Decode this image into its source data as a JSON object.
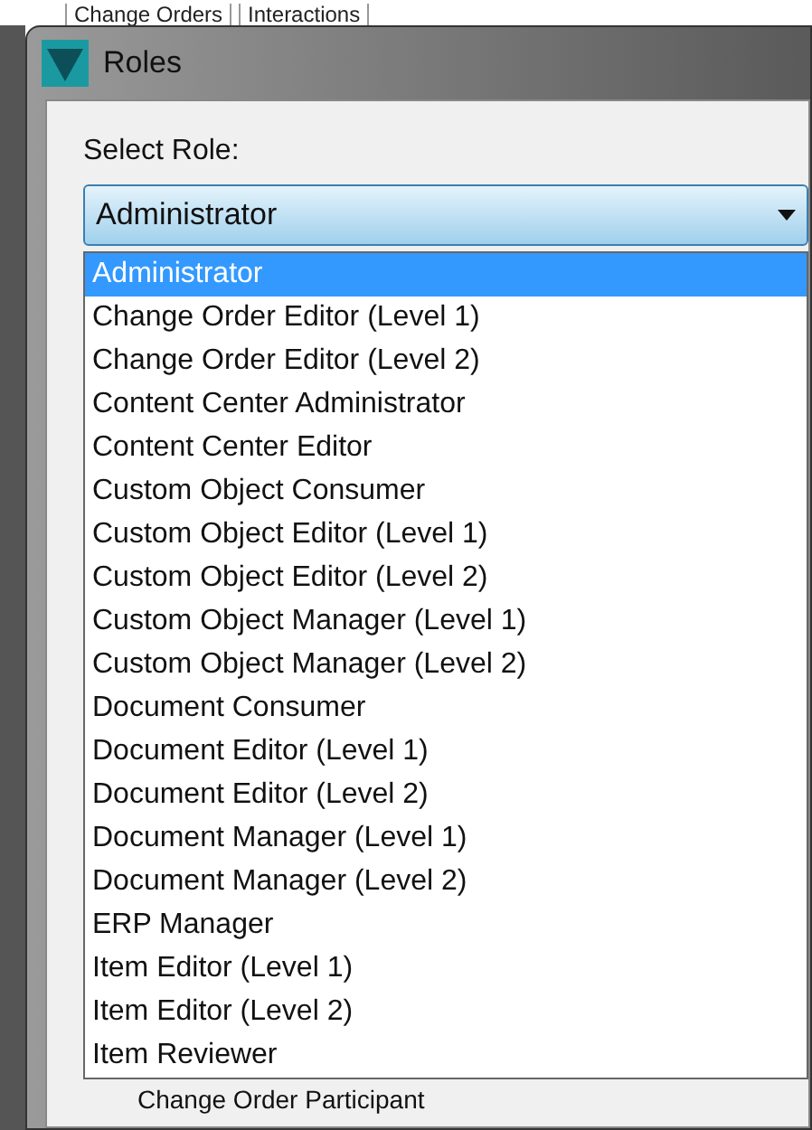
{
  "background_tabs": [
    "Change Orders",
    "Interactions"
  ],
  "window": {
    "title": "Roles"
  },
  "select_role": {
    "label": "Select Role:",
    "value": "Administrator",
    "expanded": true
  },
  "options": [
    {
      "label": "Administrator",
      "selected": true
    },
    {
      "label": "Change Order Editor (Level 1)",
      "selected": false
    },
    {
      "label": "Change Order Editor (Level 2)",
      "selected": false
    },
    {
      "label": "Content Center Administrator",
      "selected": false
    },
    {
      "label": "Content Center Editor",
      "selected": false
    },
    {
      "label": "Custom Object Consumer",
      "selected": false
    },
    {
      "label": "Custom Object Editor (Level 1)",
      "selected": false
    },
    {
      "label": "Custom Object Editor (Level 2)",
      "selected": false
    },
    {
      "label": "Custom Object Manager (Level 1)",
      "selected": false
    },
    {
      "label": "Custom Object Manager (Level 2)",
      "selected": false
    },
    {
      "label": "Document Consumer",
      "selected": false
    },
    {
      "label": "Document Editor (Level 1)",
      "selected": false
    },
    {
      "label": "Document Editor (Level 2)",
      "selected": false
    },
    {
      "label": "Document Manager (Level 1)",
      "selected": false
    },
    {
      "label": "Document Manager (Level 2)",
      "selected": false
    },
    {
      "label": "ERP Manager",
      "selected": false
    },
    {
      "label": "Item Editor (Level 1)",
      "selected": false
    },
    {
      "label": "Item Editor (Level 2)",
      "selected": false
    },
    {
      "label": "Item Reviewer",
      "selected": false
    }
  ],
  "background_list_item": "Change Order Participant"
}
